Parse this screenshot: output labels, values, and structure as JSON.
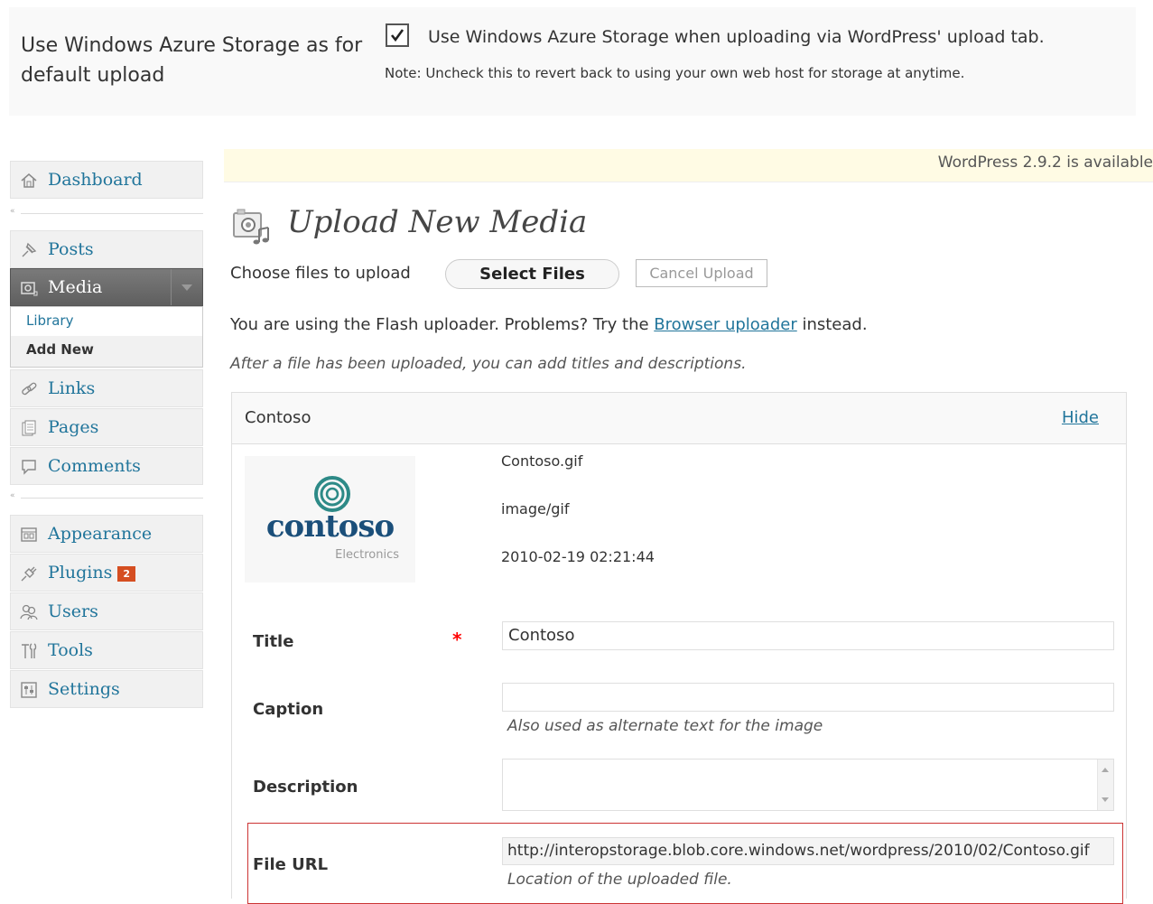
{
  "settings": {
    "label": "Use Windows Azure Storage as for default upload",
    "checkbox_label": "Use Windows Azure Storage when uploading via WordPress' upload tab.",
    "checkbox_checked": true,
    "note": "Note: Uncheck this to revert back to using your own web host for storage at anytime."
  },
  "nag": {
    "text": "WordPress 2.9.2 is available"
  },
  "menu": {
    "dashboard": "Dashboard",
    "posts": "Posts",
    "media": "Media",
    "media_sub": [
      "Library",
      "Add New"
    ],
    "links": "Links",
    "pages": "Pages",
    "comments": "Comments",
    "appearance": "Appearance",
    "plugins": "Plugins",
    "plugins_badge": "2",
    "users": "Users",
    "tools": "Tools",
    "settings": "Settings"
  },
  "main": {
    "title": "Upload New Media",
    "choose_label": "Choose files to upload",
    "select_files": "Select Files",
    "cancel_upload": "Cancel Upload",
    "flash_prefix": "You are using the Flash uploader. Problems? Try the ",
    "flash_link": "Browser uploader",
    "flash_suffix": " instead.",
    "after_upload": "After a file has been uploaded, you can add titles and descriptions."
  },
  "item": {
    "name": "Contoso",
    "hide": "Hide",
    "logo_text": "contoso",
    "logo_sub": "Electronics",
    "filename": "Contoso.gif",
    "mime": "image/gif",
    "date": "2010-02-19 02:21:44",
    "title_label": "Title",
    "required_mark": "*",
    "title_value": "Contoso",
    "caption_label": "Caption",
    "caption_value": "",
    "caption_help": "Also used as alternate text for the image",
    "description_label": "Description",
    "fileurl_label": "File URL",
    "fileurl_value": "http://interopstorage.blob.core.windows.net/wordpress/2010/02/Contoso.gif",
    "fileurl_help": "Location of the uploaded file."
  },
  "colors": {
    "link": "#21759b",
    "media_active": "#6d6d6d",
    "required": "#ff0000",
    "badge": "#d54e21",
    "logo": "#1b4f7a",
    "logo_ring": "#2d8a87"
  }
}
